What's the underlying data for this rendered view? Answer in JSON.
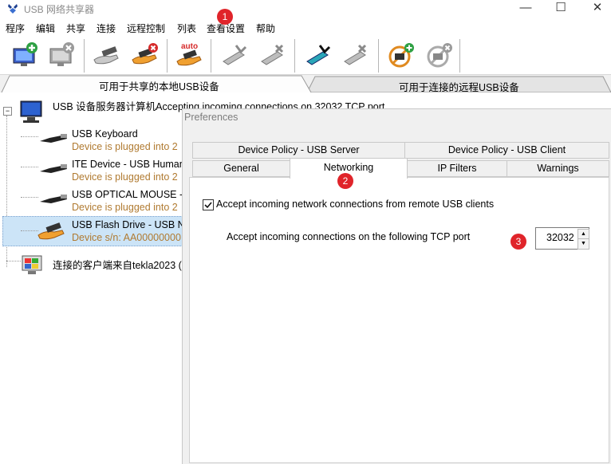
{
  "window": {
    "title": "USB 网络共享器",
    "minimize": "—",
    "maximize": "☐",
    "close": "✕"
  },
  "menu": [
    "程序",
    "编辑",
    "共享",
    "连接",
    "远程控制",
    "列表",
    "查看设置",
    "帮助"
  ],
  "toolbar": {
    "buttons": [
      {
        "name": "add-server-icon"
      },
      {
        "name": "remove-server-icon"
      },
      {
        "name": "share-device-icon"
      },
      {
        "name": "unshare-device-icon"
      },
      {
        "name": "auto-share-icon",
        "label": "auto"
      },
      {
        "name": "connect-device-icon"
      },
      {
        "name": "disconnect-device-icon"
      },
      {
        "name": "connect-all-icon"
      },
      {
        "name": "disconnect-all-icon"
      },
      {
        "name": "add-client-icon"
      },
      {
        "name": "remove-client-icon"
      }
    ]
  },
  "tabs": {
    "local": "可用于共享的本地USB设备",
    "remote": "可用于连接的远程USB设备"
  },
  "tree": {
    "server": "USB 设备服务器计算机Accepting incoming connections on 32032 TCP port",
    "devices": [
      {
        "name": "USB Keyboard",
        "sub": "Device is plugged into 2"
      },
      {
        "name": "ITE Device - USB Human",
        "sub": "Device is plugged into 2"
      },
      {
        "name": "USB OPTICAL MOUSE -",
        "sub": "Device is plugged into 2"
      },
      {
        "name": "USB Flash Drive - USB N",
        "sub": "Device s/n: AA00000000"
      }
    ],
    "client": "连接的客户端来自tekla2023 ("
  },
  "dialog": {
    "title": "Preferences",
    "tabs_top": [
      "Device Policy - USB Server",
      "Device Policy - USB Client"
    ],
    "tabs_bottom": [
      "General",
      "Networking",
      "IP Filters",
      "Warnings"
    ],
    "active_tab": "Networking",
    "accept_checkbox_label": "Accept incoming network connections from remote USB clients",
    "accept_checked": true,
    "port_label": "Accept incoming connections on the following TCP port",
    "port_value": "32032"
  },
  "annotations": [
    "1",
    "2",
    "3"
  ],
  "colors": {
    "selection": "#cce4f7",
    "badge": "#e0242a",
    "sub_text": "#b07a30"
  }
}
